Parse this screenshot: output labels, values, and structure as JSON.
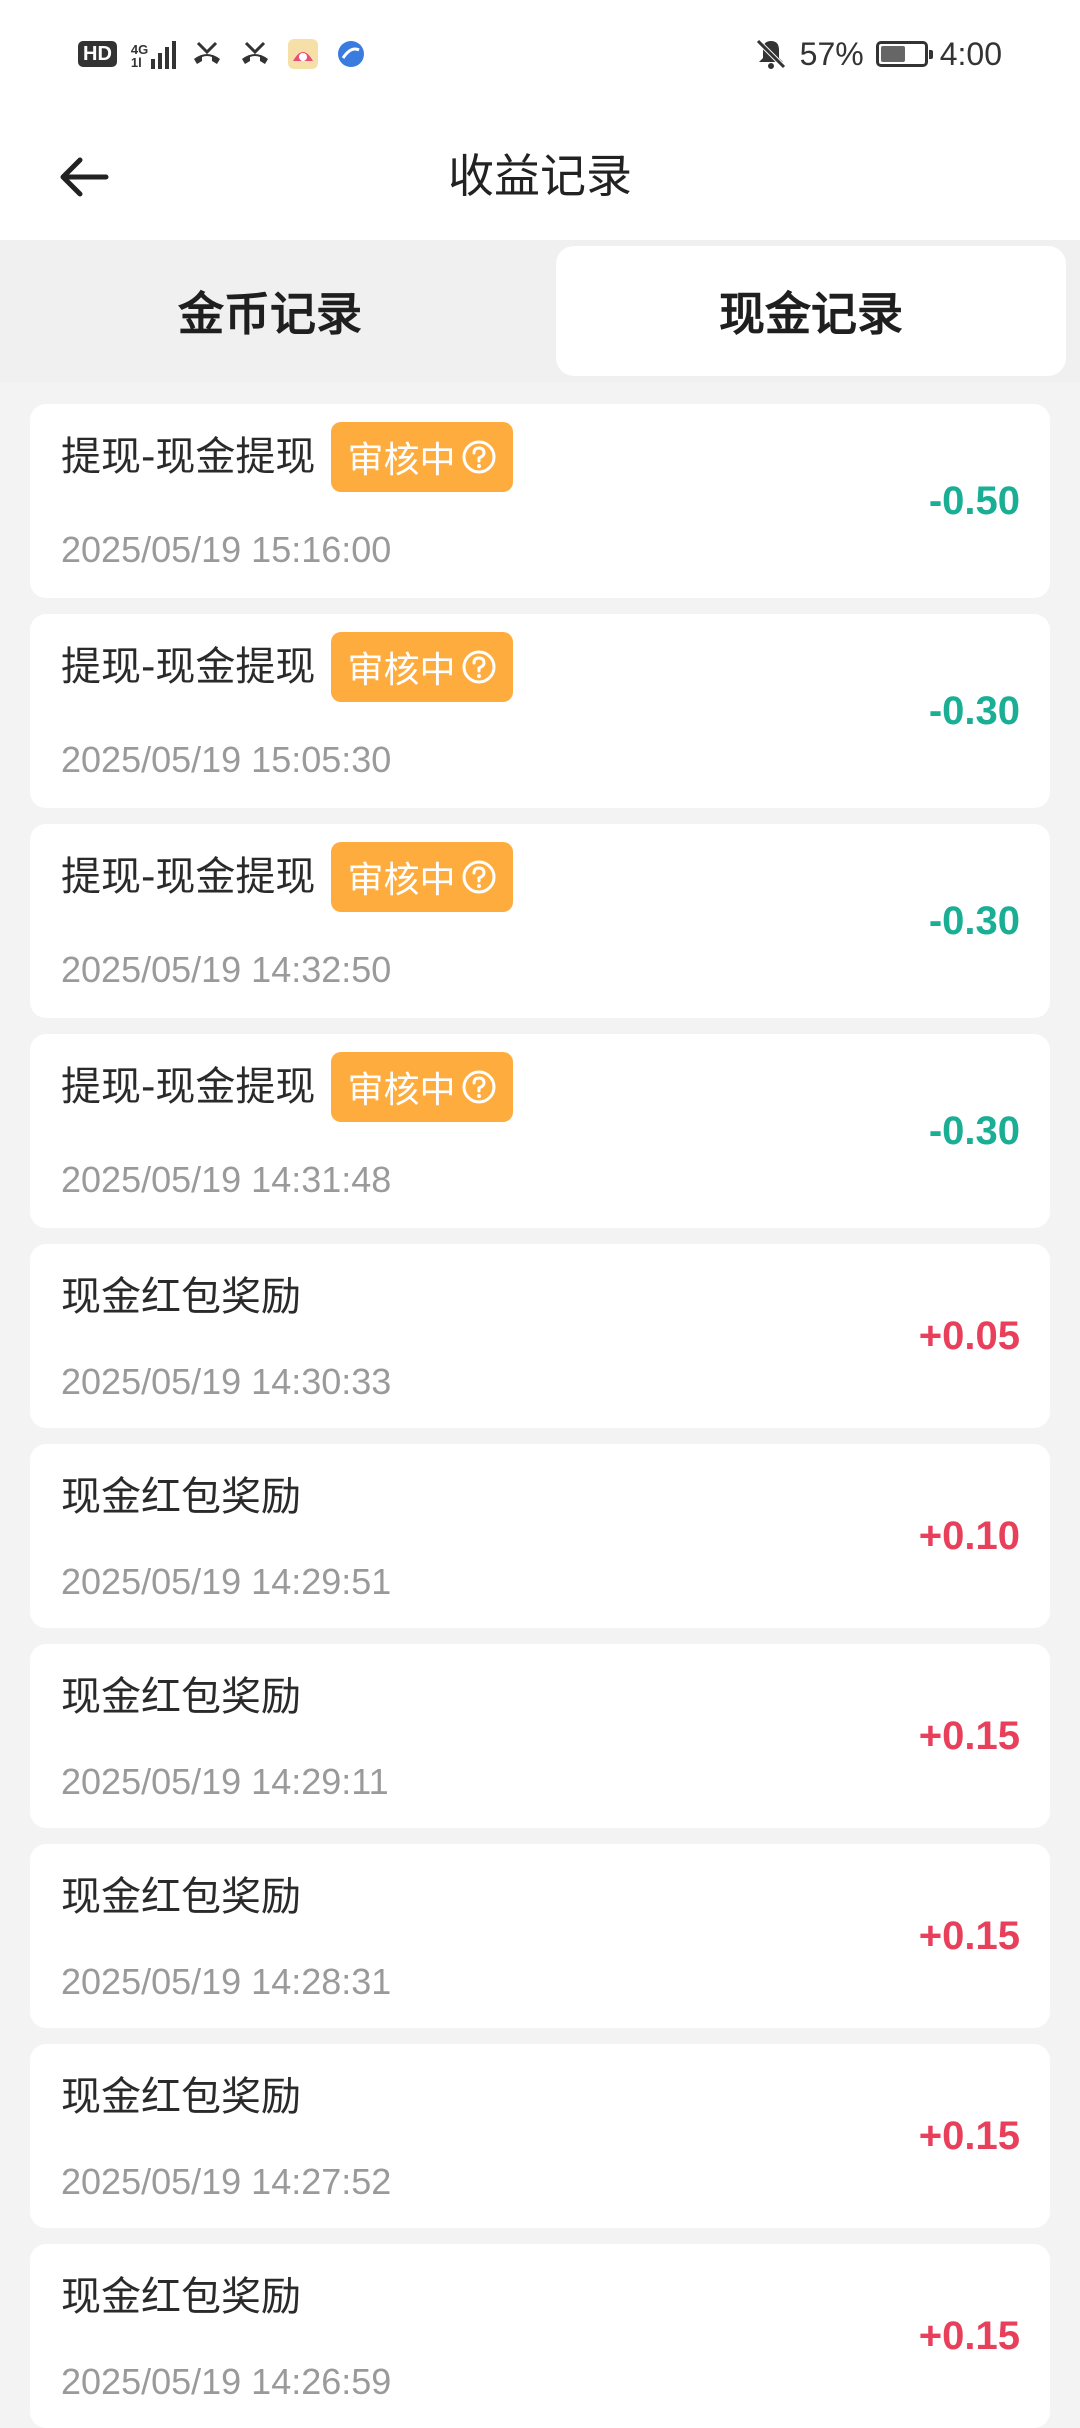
{
  "status_bar": {
    "hd_label": "HD",
    "network_label_top": "4G",
    "network_label_bottom": "1l",
    "battery_text": "57%",
    "battery_level": 0.57,
    "time": "4:00",
    "left_icons": [
      "hd-icon",
      "signal-icon",
      "missed-call-icon",
      "missed-call-icon",
      "app-icon",
      "app-icon"
    ],
    "right_icons": [
      "mute-notification-icon",
      "battery-icon"
    ]
  },
  "header": {
    "title": "收益记录",
    "back_icon": "back-arrow-icon"
  },
  "tabs": [
    {
      "label": "金币记录",
      "active": false
    },
    {
      "label": "现金记录",
      "active": true
    }
  ],
  "colors": {
    "negative_amount": "#1aae94",
    "positive_amount": "#e83f5b",
    "badge_background": "#ffac3e"
  },
  "records": [
    {
      "title": "提现-现金提现",
      "status": "审核中",
      "time": "2025/05/19 15:16:00",
      "amount": "-0.50",
      "kind": "negative"
    },
    {
      "title": "提现-现金提现",
      "status": "审核中",
      "time": "2025/05/19 15:05:30",
      "amount": "-0.30",
      "kind": "negative"
    },
    {
      "title": "提现-现金提现",
      "status": "审核中",
      "time": "2025/05/19 14:32:50",
      "amount": "-0.30",
      "kind": "negative"
    },
    {
      "title": "提现-现金提现",
      "status": "审核中",
      "time": "2025/05/19 14:31:48",
      "amount": "-0.30",
      "kind": "negative"
    },
    {
      "title": "现金红包奖励",
      "status": "",
      "time": "2025/05/19 14:30:33",
      "amount": "+0.05",
      "kind": "positive"
    },
    {
      "title": "现金红包奖励",
      "status": "",
      "time": "2025/05/19 14:29:51",
      "amount": "+0.10",
      "kind": "positive"
    },
    {
      "title": "现金红包奖励",
      "status": "",
      "time": "2025/05/19 14:29:11",
      "amount": "+0.15",
      "kind": "positive"
    },
    {
      "title": "现金红包奖励",
      "status": "",
      "time": "2025/05/19 14:28:31",
      "amount": "+0.15",
      "kind": "positive"
    },
    {
      "title": "现金红包奖励",
      "status": "",
      "time": "2025/05/19 14:27:52",
      "amount": "+0.15",
      "kind": "positive"
    },
    {
      "title": "现金红包奖励",
      "status": "",
      "time": "2025/05/19 14:26:59",
      "amount": "+0.15",
      "kind": "positive"
    }
  ]
}
